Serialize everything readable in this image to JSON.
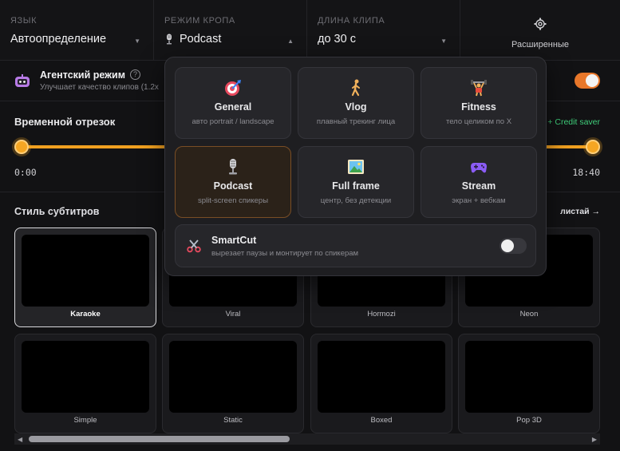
{
  "topbar": {
    "language": {
      "label": "Язык",
      "value": "Автоопределение",
      "icon": "chevron-down-icon"
    },
    "crop_mode": {
      "label": "Режим кропа",
      "value": "Podcast",
      "icon": "microphone-icon",
      "caret": "chevron-up-icon"
    },
    "clip_length": {
      "label": "Длина клипа",
      "value": "до 30 с",
      "icon": "chevron-down-icon"
    },
    "advanced": {
      "label": "Расширенные",
      "icon": "gear-icon"
    }
  },
  "agent": {
    "title": "Агентский режим",
    "subtitle": "Улучшает качество клипов (1.2x",
    "help": "?",
    "enabled": true
  },
  "time_segment": {
    "title": "Временной отрезок",
    "credit_saver": "+ Credit saver",
    "start": "0:00",
    "end": "18:40"
  },
  "subtitles": {
    "title": "Стиль субтитров",
    "browse": "листай →",
    "styles": [
      {
        "name": "Karaoke",
        "selected": true
      },
      {
        "name": "Viral",
        "selected": false
      },
      {
        "name": "Hormozi",
        "selected": false
      },
      {
        "name": "Neon",
        "selected": false
      },
      {
        "name": "Simple",
        "selected": false
      },
      {
        "name": "Static",
        "selected": false
      },
      {
        "name": "Boxed",
        "selected": false
      },
      {
        "name": "Pop 3D",
        "selected": false
      }
    ]
  },
  "crop_dropdown": {
    "modes": [
      {
        "title": "General",
        "subtitle": "авто portrait / landscape",
        "icon": "target-icon",
        "selected": false
      },
      {
        "title": "Vlog",
        "subtitle": "плавный трекинг лица",
        "icon": "walking-person-icon",
        "selected": false
      },
      {
        "title": "Fitness",
        "subtitle": "тело целиком по X",
        "icon": "weightlifter-icon",
        "selected": false
      },
      {
        "title": "Podcast",
        "subtitle": "split-screen спикеры",
        "icon": "microphone-icon",
        "selected": true
      },
      {
        "title": "Full frame",
        "subtitle": "центр, без детекции",
        "icon": "landscape-picture-icon",
        "selected": false
      },
      {
        "title": "Stream",
        "subtitle": "экран + вебкам",
        "icon": "gamepad-icon",
        "selected": false
      }
    ],
    "smartcut": {
      "title": "SmartCut",
      "subtitle": "вырезает паузы и монтирует по спикерам",
      "icon": "scissors-icon",
      "enabled": false
    }
  },
  "colors": {
    "accent": "#f5a623",
    "toggle_on": "#e8772a",
    "credit_saver": "#3fcf7a",
    "background": "#121214"
  }
}
